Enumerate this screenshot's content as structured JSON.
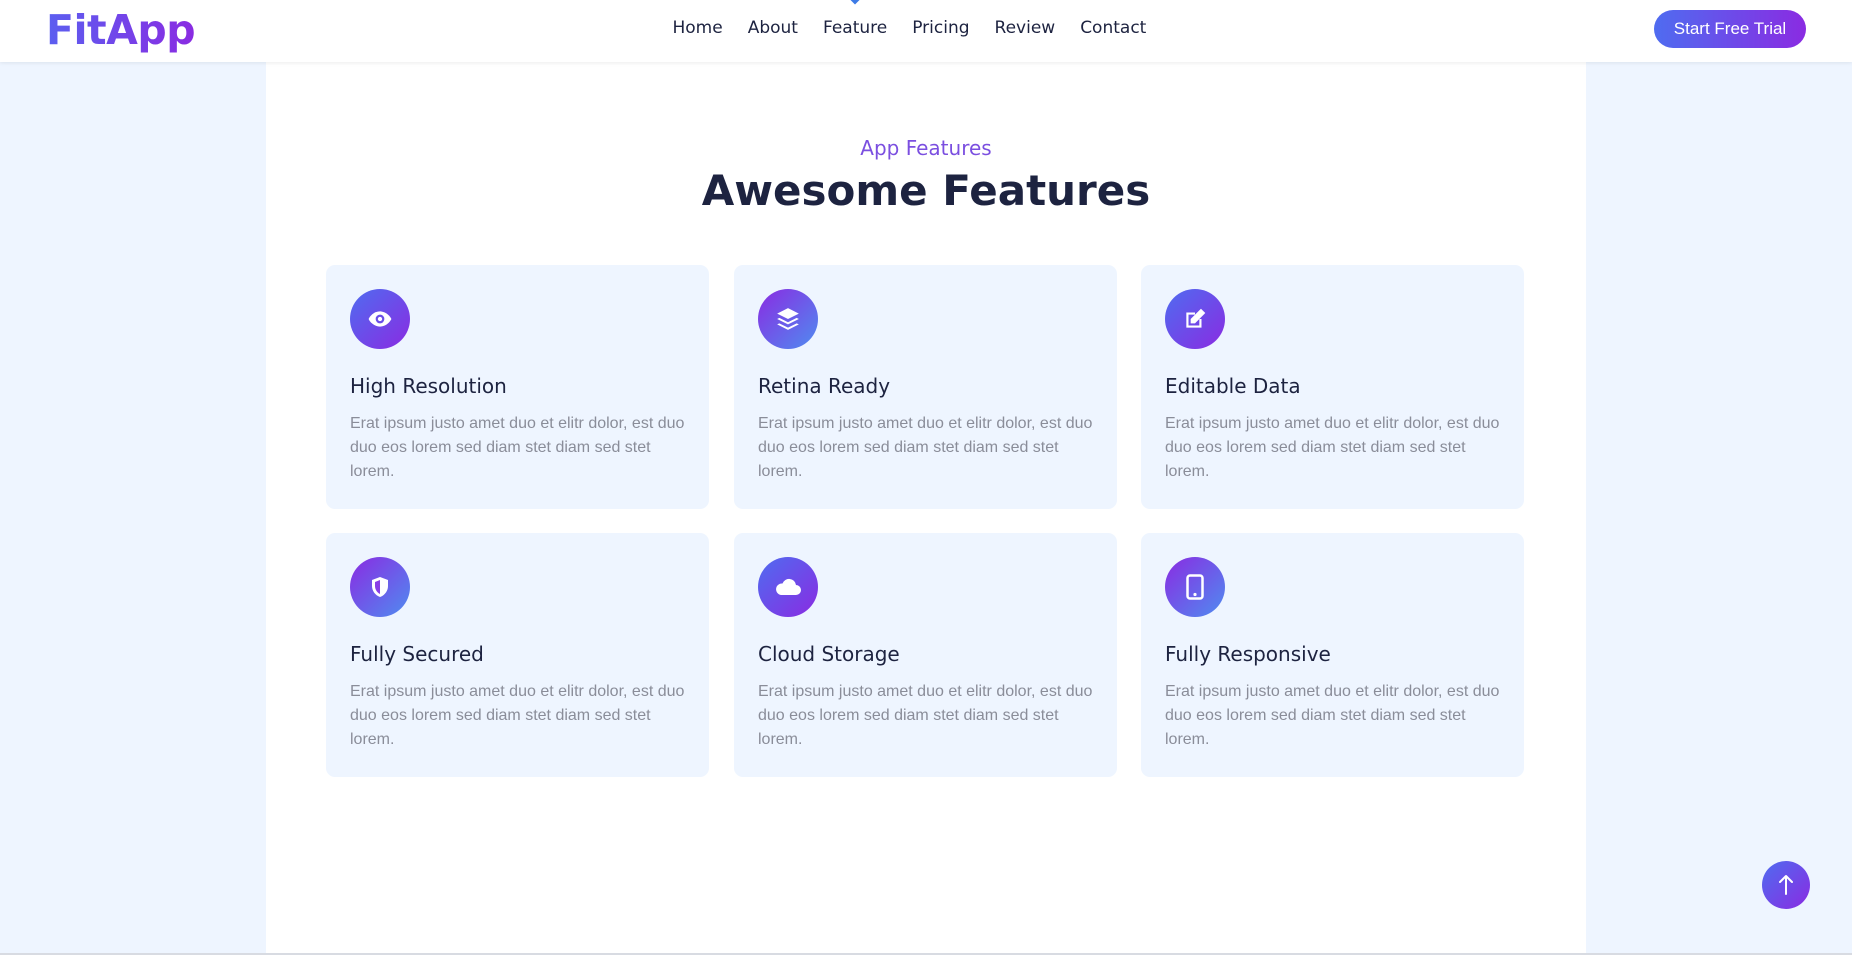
{
  "brand": "FitApp",
  "nav": {
    "items": [
      {
        "label": "Home",
        "active": false
      },
      {
        "label": "About",
        "active": false
      },
      {
        "label": "Feature",
        "active": true
      },
      {
        "label": "Pricing",
        "active": false
      },
      {
        "label": "Review",
        "active": false
      },
      {
        "label": "Contact",
        "active": false
      }
    ],
    "cta": "Start Free Trial"
  },
  "section": {
    "eyebrow": "App Features",
    "title": "Awesome Features"
  },
  "features": [
    {
      "title": "High Resolution",
      "text": "Erat ipsum justo amet duo et elitr dolor, est duo duo eos lorem sed diam stet diam sed stet lorem.",
      "icon": "eye-icon"
    },
    {
      "title": "Retina Ready",
      "text": "Erat ipsum justo amet duo et elitr dolor, est duo duo eos lorem sed diam stet diam sed stet lorem.",
      "icon": "layers-icon"
    },
    {
      "title": "Editable Data",
      "text": "Erat ipsum justo amet duo et elitr dolor, est duo duo eos lorem sed diam stet diam sed stet lorem.",
      "icon": "edit-icon"
    },
    {
      "title": "Fully Secured",
      "text": "Erat ipsum justo amet duo et elitr dolor, est duo duo eos lorem sed diam stet diam sed stet lorem.",
      "icon": "shield-icon"
    },
    {
      "title": "Cloud Storage",
      "text": "Erat ipsum justo amet duo et elitr dolor, est duo duo eos lorem sed diam stet diam sed stet lorem.",
      "icon": "cloud-icon"
    },
    {
      "title": "Fully Responsive",
      "text": "Erat ipsum justo amet duo et elitr dolor, est duo duo eos lorem sed diam stet diam sed stet lorem.",
      "icon": "mobile-icon"
    }
  ],
  "scroll_top_icon": "arrow-up-icon",
  "colors": {
    "accent_start": "#4f6cf0",
    "accent_end": "#8a2be2",
    "page_bg": "#eef5ff",
    "heading": "#1d2340",
    "body_text": "#8a8d99",
    "eyebrow": "#7b4fe0"
  }
}
